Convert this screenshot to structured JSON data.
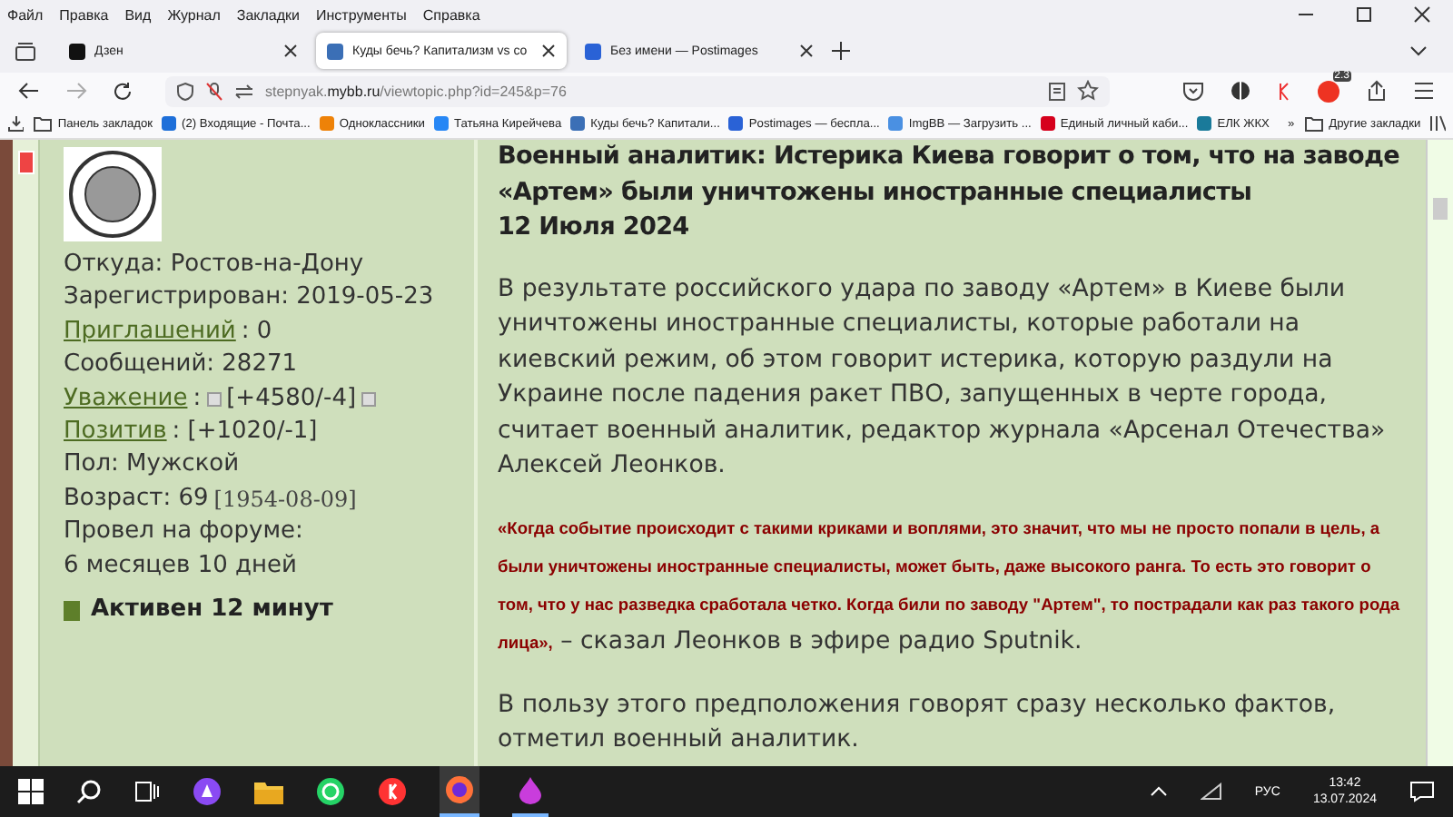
{
  "menu_bar": [
    "Файл",
    "Правка",
    "Вид",
    "Журнал",
    "Закладки",
    "Инструменты",
    "Справка"
  ],
  "tabs": [
    {
      "label": "Дзен",
      "selected": false
    },
    {
      "label": "Куды бечь? Капитализм vs со",
      "selected": true
    },
    {
      "label": "Без имени — Postimages",
      "selected": false
    }
  ],
  "address_bar": {
    "host_prefix": "stepnyak.",
    "host_domain": "mybb.ru",
    "path": "/viewtopic.php?id=245&p=76"
  },
  "extension_badge": "2.3",
  "bookmarks": [
    {
      "label": "Панель закладок",
      "kind": "folder"
    },
    {
      "label": "(2) Входящие - Почта...",
      "kind": "site"
    },
    {
      "label": "Одноклассники",
      "kind": "site"
    },
    {
      "label": "Татьяна Кирейчева",
      "kind": "site"
    },
    {
      "label": "Куды бечь? Капитали...",
      "kind": "site"
    },
    {
      "label": "Postimages — беспла...",
      "kind": "site"
    },
    {
      "label": "ImgBB — Загрузить ...",
      "kind": "site"
    },
    {
      "label": "Единый личный каби...",
      "kind": "site"
    },
    {
      "label": "ЕЛК ЖКХ",
      "kind": "site"
    }
  ],
  "bookmarks_overflow": "»",
  "other_bookmarks": "Другие закладки",
  "profile": {
    "fields": [
      {
        "label": "Откуда:",
        "value": "Ростов-на-Дону",
        "kind": "plain"
      },
      {
        "label": "Зарегистрирован:",
        "value": "2019-05-23",
        "kind": "plain"
      },
      {
        "label": "Приглашений",
        "value": ": 0",
        "kind": "link"
      },
      {
        "label": "Сообщений:",
        "value": "28271",
        "kind": "plain"
      },
      {
        "label": "Уважение",
        "value": ":",
        "rating": "[+4580/-4]",
        "kind": "vote"
      },
      {
        "label": "Позитив",
        "value": ": [+1020/-1]",
        "kind": "link"
      },
      {
        "label": "Пол:",
        "value": "Мужской",
        "kind": "plain"
      },
      {
        "label": "Возраст:",
        "value": "69",
        "extra": "[1954-08-09]",
        "kind": "plain"
      },
      {
        "label": "Провел на форуме:",
        "value": "6 месяцев 10 дней",
        "kind": "wrapped"
      }
    ],
    "activity": "Активен 12 минут"
  },
  "post": {
    "title": "Военный аналитик: Истерика Киева говорит о том, что на заводе «Артем» были уничтожены иностранные специалисты",
    "date": "12 Июля 2024",
    "paragraphs": [
      {
        "kind": "text",
        "text": "В результате российского удара по заводу «Артем» в Киеве были уничтожены иностранные специалисты, которые работали на киевский режим, об этом говорит истерика, которую раздули на Украине после падения ракет ПВО, запущенных в черте города, считает военный аналитик, редактор журнала «Арсенал Отечества» Алексей Леонков."
      },
      {
        "kind": "quote",
        "quote": "«Когда событие происходит с такими криками и воплями, это значит, что мы не просто попали в цель, а были уничтожены иностранные специалисты, может быть, даже высокого ранга. То есть это говорит о том, что у нас разведка сработала четко. Когда били по заводу \"Артем\", то пострадали как раз такого рода лица»,",
        "text": " – сказал Леонков в эфире радио Sputnik."
      },
      {
        "kind": "text",
        "text": "В пользу этого предположения говорят сразу несколько фактов, отметил военный аналитик."
      }
    ]
  },
  "taskbar": {
    "language": "РУС",
    "time": "13:42",
    "date": "13.07.2024"
  }
}
